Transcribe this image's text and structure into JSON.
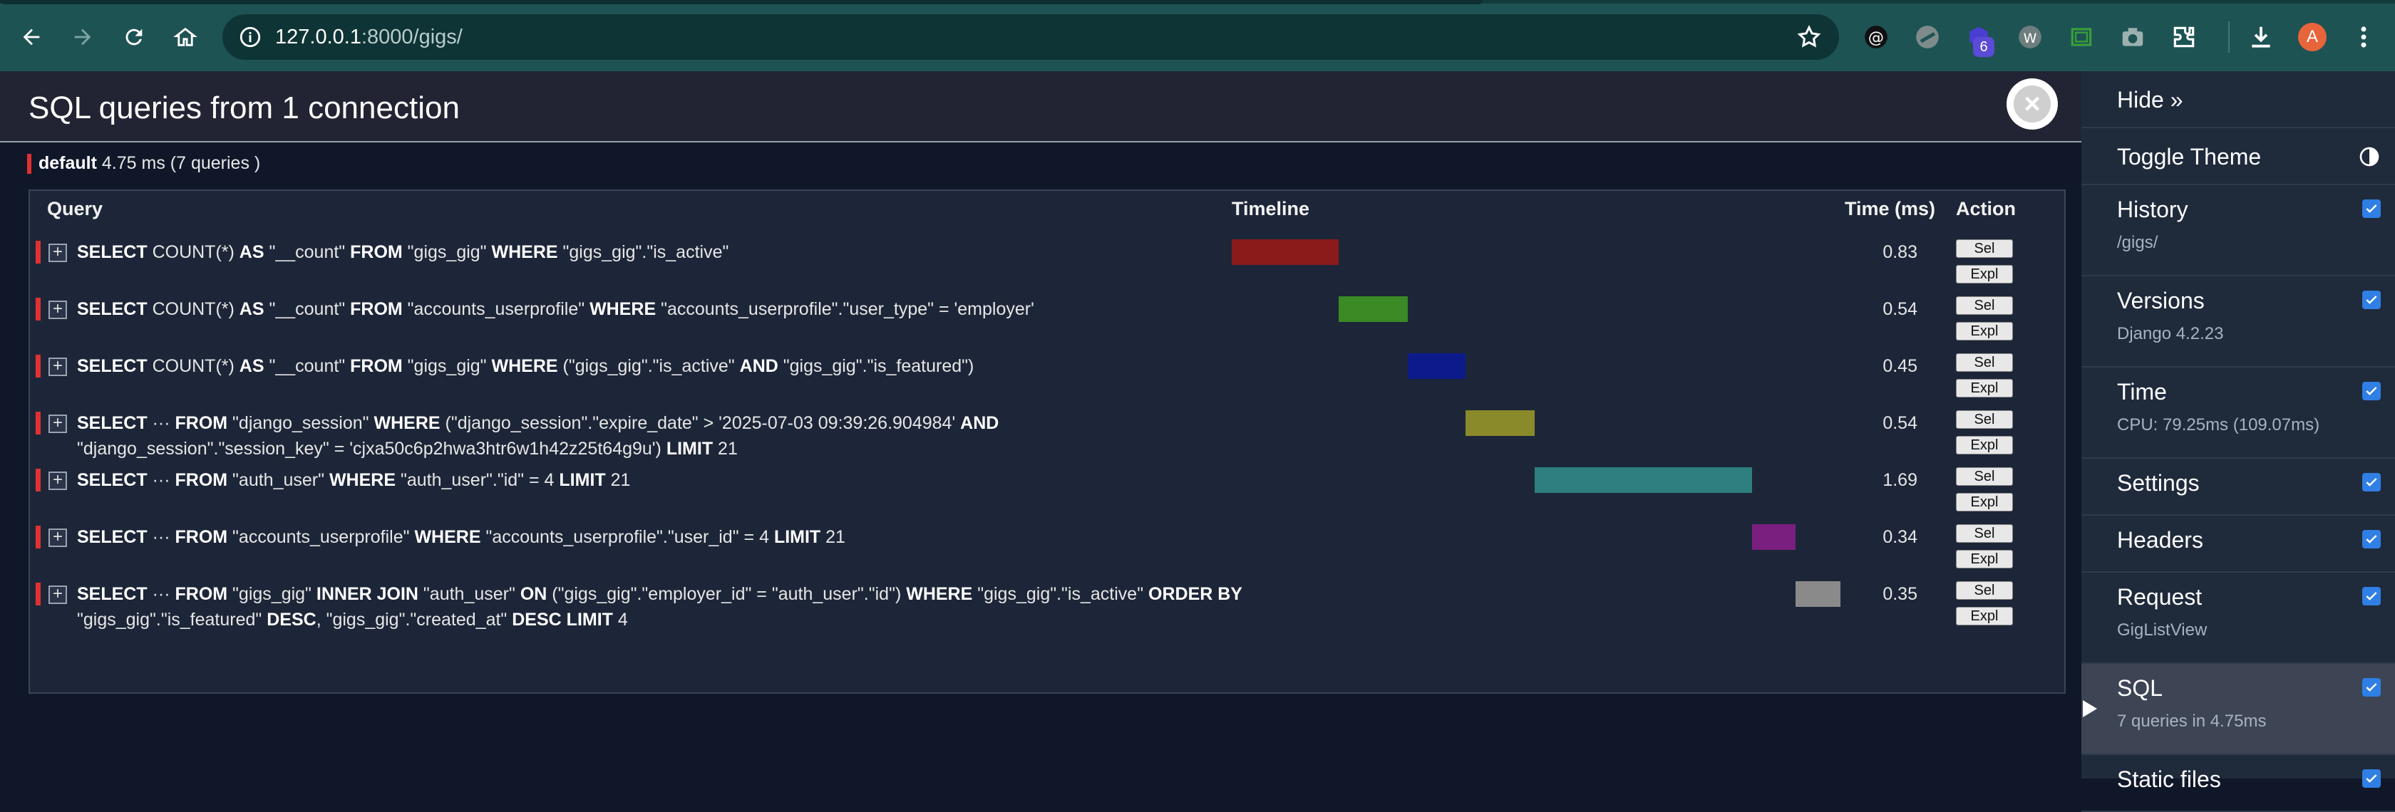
{
  "browser": {
    "url_host": "127.0.0.1",
    "url_path": ":8000/gigs/",
    "extension_badge": "6",
    "profile_initial": "A"
  },
  "panel": {
    "title": "SQL queries from 1 connection",
    "db_alias": "default",
    "db_summary": "4.75 ms (7 queries )",
    "headers": {
      "query": "Query",
      "timeline": "Timeline",
      "time": "Time (ms)",
      "action": "Action"
    },
    "button_sel": "Sel",
    "button_expl": "Expl",
    "total_time_ms": 4.75,
    "queries": [
      {
        "sql": [
          {
            "kw": "SELECT"
          },
          {
            "t": " COUNT(*) "
          },
          {
            "kw": "AS"
          },
          {
            "t": " \"__count\" "
          },
          {
            "kw": "FROM"
          },
          {
            "t": " \"gigs_gig\" "
          },
          {
            "kw": "WHERE"
          },
          {
            "t": " \"gigs_gig\".\"is_active\""
          }
        ],
        "time": "0.83",
        "color": "#8b1a1a"
      },
      {
        "sql": [
          {
            "kw": "SELECT"
          },
          {
            "t": " COUNT(*) "
          },
          {
            "kw": "AS"
          },
          {
            "t": " \"__count\" "
          },
          {
            "kw": "FROM"
          },
          {
            "t": " \"accounts_userprofile\" "
          },
          {
            "kw": "WHERE"
          },
          {
            "t": " \"accounts_userprofile\".\"user_type\" = 'employer'"
          }
        ],
        "time": "0.54",
        "color": "#3a8a25"
      },
      {
        "sql": [
          {
            "kw": "SELECT"
          },
          {
            "t": " COUNT(*) "
          },
          {
            "kw": "AS"
          },
          {
            "t": " \"__count\" "
          },
          {
            "kw": "FROM"
          },
          {
            "t": " \"gigs_gig\" "
          },
          {
            "kw": "WHERE"
          },
          {
            "t": " (\"gigs_gig\".\"is_active\" "
          },
          {
            "kw": "AND"
          },
          {
            "t": " \"gigs_gig\".\"is_featured\")"
          }
        ],
        "time": "0.45",
        "color": "#0d1b8a"
      },
      {
        "sql": [
          {
            "kw": "SELECT"
          },
          {
            "t": " ··· "
          },
          {
            "kw": "FROM"
          },
          {
            "t": " \"django_session\" "
          },
          {
            "kw": "WHERE"
          },
          {
            "t": " (\"django_session\".\"expire_date\" > '2025-07-03 09:39:26.904984' "
          },
          {
            "kw": "AND"
          },
          {
            "t": " \"django_session\".\"session_key\" = 'cjxa50c6p2hwa3htr6w1h42z25t64g9u') "
          },
          {
            "kw": "LIMIT"
          },
          {
            "t": " 21"
          }
        ],
        "time": "0.54",
        "color": "#8a8a2a"
      },
      {
        "sql": [
          {
            "kw": "SELECT"
          },
          {
            "t": " ··· "
          },
          {
            "kw": "FROM"
          },
          {
            "t": " \"auth_user\" "
          },
          {
            "kw": "WHERE"
          },
          {
            "t": " \"auth_user\".\"id\" = 4 "
          },
          {
            "kw": "LIMIT"
          },
          {
            "t": " 21"
          }
        ],
        "time": "1.69",
        "color": "#2e7f80"
      },
      {
        "sql": [
          {
            "kw": "SELECT"
          },
          {
            "t": " ··· "
          },
          {
            "kw": "FROM"
          },
          {
            "t": " \"accounts_userprofile\" "
          },
          {
            "kw": "WHERE"
          },
          {
            "t": " \"accounts_userprofile\".\"user_id\" = 4 "
          },
          {
            "kw": "LIMIT"
          },
          {
            "t": " 21"
          }
        ],
        "time": "0.34",
        "color": "#7a1f7f"
      },
      {
        "sql": [
          {
            "kw": "SELECT"
          },
          {
            "t": " ··· "
          },
          {
            "kw": "FROM"
          },
          {
            "t": " \"gigs_gig\" "
          },
          {
            "kw": "INNER JOIN"
          },
          {
            "t": " \"auth_user\" "
          },
          {
            "kw": "ON"
          },
          {
            "t": " (\"gigs_gig\".\"employer_id\" = \"auth_user\".\"id\") "
          },
          {
            "kw": "WHERE"
          },
          {
            "t": " \"gigs_gig\".\"is_active\" "
          },
          {
            "kw": "ORDER BY"
          },
          {
            "t": " \"gigs_gig\".\"is_featured\" "
          },
          {
            "kw": "DESC"
          },
          {
            "t": ", \"gigs_gig\".\"created_at\" "
          },
          {
            "kw": "DESC"
          },
          {
            "t": " "
          },
          {
            "kw": "LIMIT"
          },
          {
            "t": " 4"
          }
        ],
        "time": "0.35",
        "color": "#8a8a8a"
      }
    ]
  },
  "sidebar": {
    "hide_label": "Hide »",
    "toggle_theme_label": "Toggle Theme",
    "items": [
      {
        "label": "History",
        "sub": "/gigs/",
        "checked": true
      },
      {
        "label": "Versions",
        "sub": "Django 4.2.23",
        "checked": true
      },
      {
        "label": "Time",
        "sub": "CPU: 79.25ms (109.07ms)",
        "checked": true
      },
      {
        "label": "Settings",
        "sub": "",
        "checked": true
      },
      {
        "label": "Headers",
        "sub": "",
        "checked": true
      },
      {
        "label": "Request",
        "sub": "GigListView",
        "checked": true
      },
      {
        "label": "SQL",
        "sub": "7 queries in 4.75ms",
        "checked": true,
        "active": true
      },
      {
        "label": "Static files",
        "sub": "",
        "checked": true
      }
    ]
  }
}
